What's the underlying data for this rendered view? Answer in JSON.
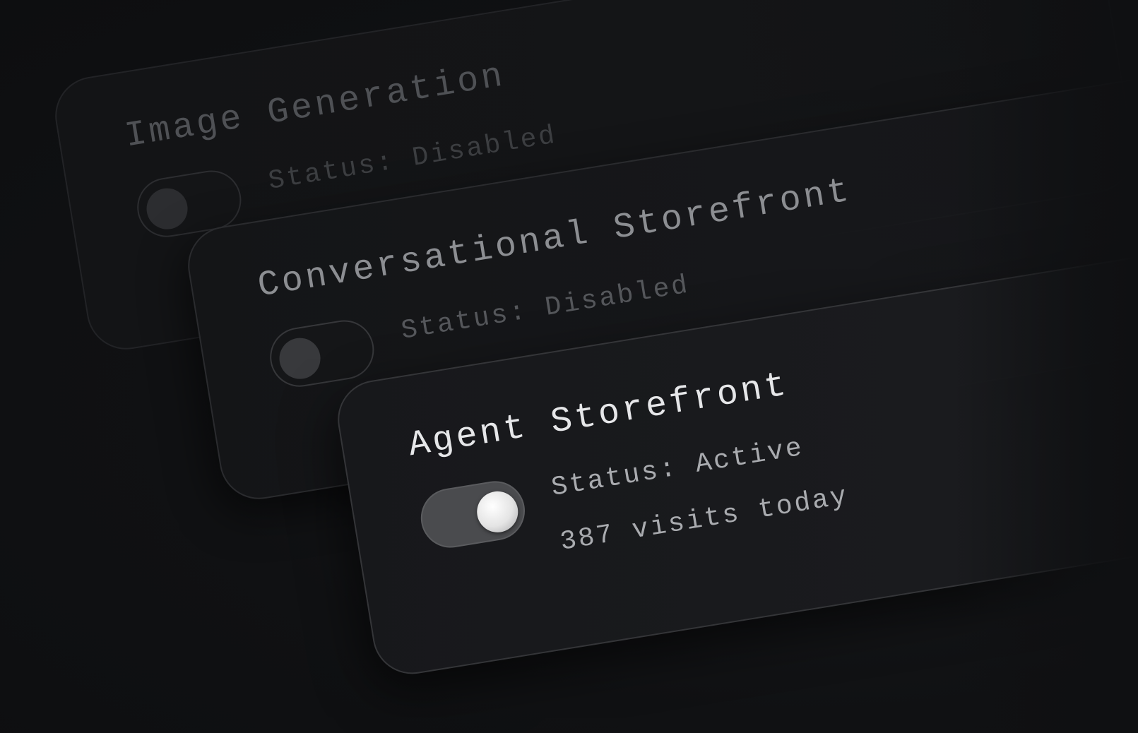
{
  "cards": [
    {
      "title": "Image Generation",
      "status": "Status: Disabled",
      "enabled": false
    },
    {
      "title": "Conversational Storefront",
      "status": "Status: Disabled",
      "enabled": false
    },
    {
      "title": "Agent Storefront",
      "status": "Status: Active",
      "visits": "387 visits today",
      "enabled": true
    }
  ],
  "colors": {
    "background": "#0f1012",
    "active_text": "#e6e7e9",
    "muted_text": "#55575b",
    "toggle_on_track": "#4a4b4e",
    "toggle_knob": "#ffffff"
  }
}
